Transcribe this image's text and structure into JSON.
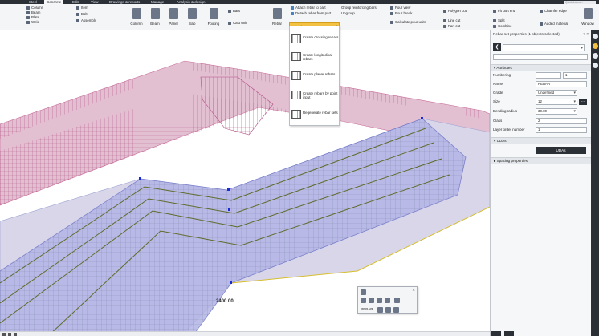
{
  "tabs": [
    "Steel",
    "Concrete",
    "Edit",
    "View",
    "Drawings & reports",
    "Manage",
    "Analysis & design"
  ],
  "active_tab": "Concrete",
  "search_placeholder": "Quick Launch",
  "ribbon": {
    "column_list": [
      "Column",
      "Beam",
      "Plate",
      "Weld"
    ],
    "mid_list": [
      "Item",
      "Bolt",
      "Assembly"
    ],
    "big_buttons": [
      "Column",
      "Beam",
      "Panel",
      "Slab",
      "Footing"
    ],
    "bars_label": "Bars",
    "cast_unit_label": "Cast unit",
    "rebar_label": "Rebar",
    "rebar_actions": [
      "Attach rebar to part",
      "Detach rebar from part"
    ],
    "rebar_set_label": "Rebar set",
    "group_actions": [
      "Group reinforcing bars",
      "Ungroup"
    ],
    "pour_actions": [
      "Pour view",
      "Pour break",
      "Calculate pour units"
    ],
    "cut_actions": [
      "Polygon cut",
      "Line cut",
      "Part cut"
    ],
    "edit_actions": [
      "Fit part end",
      "Split",
      "Combine"
    ],
    "misc_actions": [
      "Chamfer edge",
      "Added material"
    ],
    "window_label": "Window"
  },
  "rebar_menu": [
    "Create crossing rebars",
    "Create longitudinal rebars",
    "Create planar rebars",
    "Create rebars by point input",
    "Regenerate rebar sets"
  ],
  "viewport": {
    "dimension_text": "2400.00"
  },
  "panel": {
    "title": "Rebar set properties (1 objects selected)",
    "close_glyph": "? ✕",
    "back_glyph": "❮",
    "attributes_title": "Attributes",
    "fields": {
      "numbering_label": "Numbering",
      "numbering_prefix": "",
      "numbering_start": "1",
      "name_label": "Name",
      "name_value": "REBAR",
      "grade_label": "Grade",
      "grade_value": "Undefined",
      "size_label": "Size",
      "size_value": "12",
      "bending_radius_label": "Bending radius",
      "bending_radius_value": "30.00",
      "class_label": "Class",
      "class_value": "2",
      "layer_order_label": "Layer order number",
      "layer_order_value": "1"
    },
    "more_glyph": "…",
    "udas_title": "UDAs",
    "udas_button": "UDAs",
    "spacing_title": "Spacing properties"
  },
  "mini_toolbar": {
    "label": "REBAR",
    "close": "✕"
  },
  "colors": {
    "accent": "#f4c243",
    "dark": "#2b2f36",
    "wall_pink": "#c86e9a",
    "slab_blue": "#8e9ee0",
    "rebar_green": "#5f6b2a"
  }
}
